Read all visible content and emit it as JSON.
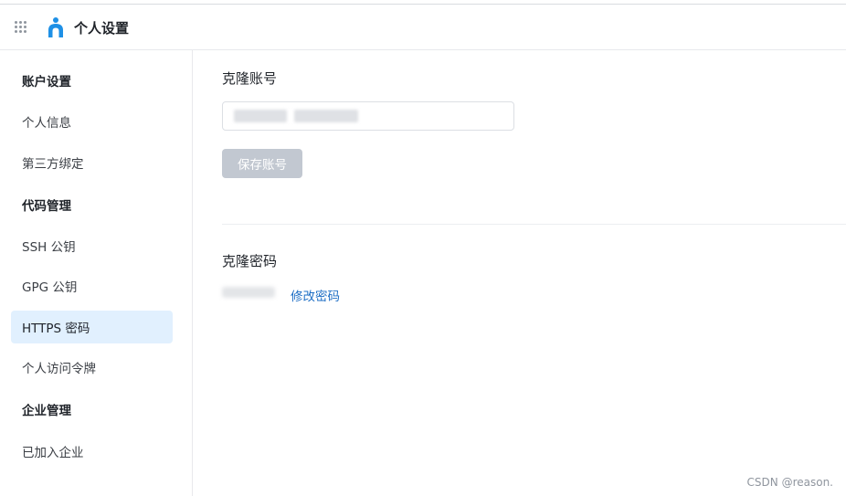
{
  "header": {
    "title": "个人设置",
    "grid_icon": "apps-grid-icon",
    "logo_icon": "person-logo-icon"
  },
  "sidebar": {
    "items": [
      {
        "label": "账户设置",
        "type": "group"
      },
      {
        "label": "个人信息",
        "type": "item"
      },
      {
        "label": "第三方绑定",
        "type": "item"
      },
      {
        "label": "代码管理",
        "type": "group"
      },
      {
        "label": "SSH 公钥",
        "type": "item"
      },
      {
        "label": "GPG 公钥",
        "type": "item"
      },
      {
        "label": "HTTPS 密码",
        "type": "item",
        "active": true
      },
      {
        "label": "个人访问令牌",
        "type": "item"
      },
      {
        "label": "企业管理",
        "type": "group"
      },
      {
        "label": "已加入企业",
        "type": "item"
      }
    ],
    "active_color": "#e1f0fe"
  },
  "main": {
    "clone_account": {
      "title": "克隆账号",
      "input_value": "",
      "save_label": "保存账号"
    },
    "clone_password": {
      "title": "克隆密码",
      "change_link": "修改密码"
    }
  },
  "watermark": "CSDN @reason.",
  "colors": {
    "link": "#1f6fc5",
    "button_disabled": "#c2c8d1",
    "brand": "#1e90e6"
  }
}
